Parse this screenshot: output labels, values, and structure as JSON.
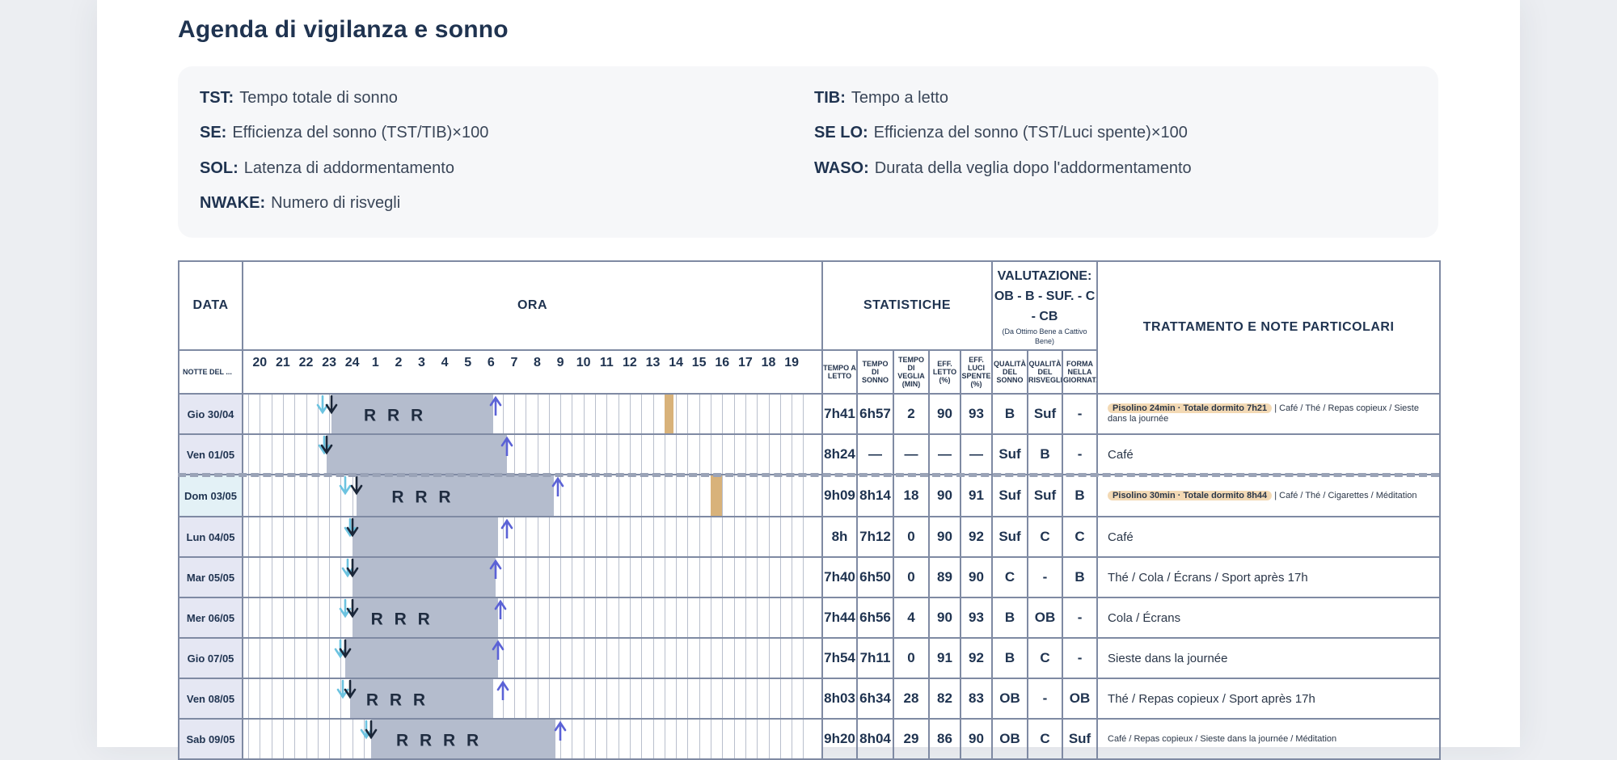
{
  "page": {
    "title": "Agenda di vigilanza e sonno"
  },
  "legend": [
    {
      "abbr": "TST:",
      "text": "Tempo totale di sonno"
    },
    {
      "abbr": "TIB:",
      "text": "Tempo a letto"
    },
    {
      "abbr": "SE:",
      "text": "Efficienza del sonno (TST/TIB)×100"
    },
    {
      "abbr": "SE LO:",
      "text": "Efficienza del sonno (TST/Luci spente)×100"
    },
    {
      "abbr": "SOL:",
      "text": "Latenza di addormentamento"
    },
    {
      "abbr": "WASO:",
      "text": "Durata della veglia dopo l'addormentamento"
    },
    {
      "abbr": "NWAKE:",
      "text": "Numero di risvegli"
    }
  ],
  "table": {
    "headers": {
      "data": "DATA",
      "ora": "ORA",
      "statistiche": "STATISTICHE",
      "valutazione": "VALUTAZIONE: OB - B - SUF. - C - CB",
      "valutazione_note": "(Da Ottimo Bene a Cattivo Bene)",
      "trattamento": "TRATTAMENTO E NOTE PARTICOLARI",
      "notte_del": "NOTTE DEL ..."
    },
    "hours": [
      "20",
      "21",
      "22",
      "23",
      "24",
      "1",
      "2",
      "3",
      "4",
      "5",
      "6",
      "7",
      "8",
      "9",
      "10",
      "11",
      "12",
      "13",
      "14",
      "15",
      "16",
      "17",
      "18",
      "19"
    ],
    "stat_columns": [
      "TEMPO A LETTO",
      "TEMPO DI SONNO",
      "TEMPO DI VEGLIA (MIN)",
      "EFF. LETTO (%)",
      "EFF. LUCI SPENTE (%)"
    ],
    "eval_columns": [
      "QUALITÀ DEL SONNO",
      "QUALITÀ DEL RISVEGLIO",
      "FORMA NELLA GIORNATA"
    ],
    "rows": [
      {
        "date": "Gio 30/04",
        "stats": [
          "7h41",
          "6h57",
          "2",
          "90",
          "93"
        ],
        "eval": [
          "B",
          "Suf",
          "-"
        ],
        "pill": "Pisolino 24min · Totale dormito 7h21",
        "note": "| Café / Thé / Repas copieux / Sieste dans la journée",
        "small": true
      },
      {
        "date": "Ven 01/05",
        "stats": [
          "8h24",
          "—",
          "—",
          "—",
          "—"
        ],
        "eval": [
          "Suf",
          "B",
          "-"
        ],
        "pill": "",
        "note": "Café",
        "small": false
      },
      {
        "date": "Dom 03/05",
        "stats": [
          "9h09",
          "8h14",
          "18",
          "90",
          "91"
        ],
        "eval": [
          "Suf",
          "Suf",
          "B"
        ],
        "pill": "Pisolino 30min · Totale dormito 8h44",
        "note": "| Café / Thé / Cigarettes / Méditation",
        "small": true
      },
      {
        "date": "Lun 04/05",
        "stats": [
          "8h",
          "7h12",
          "0",
          "90",
          "92"
        ],
        "eval": [
          "Suf",
          "C",
          "C"
        ],
        "pill": "",
        "note": "Café",
        "small": false
      },
      {
        "date": "Mar 05/05",
        "stats": [
          "7h40",
          "6h50",
          "0",
          "89",
          "90"
        ],
        "eval": [
          "C",
          "-",
          "B"
        ],
        "pill": "",
        "note": "Thé / Cola / Écrans / Sport après 17h",
        "small": false
      },
      {
        "date": "Mer 06/05",
        "stats": [
          "7h44",
          "6h56",
          "4",
          "90",
          "93"
        ],
        "eval": [
          "B",
          "OB",
          "-"
        ],
        "pill": "",
        "note": "Cola / Écrans",
        "small": false
      },
      {
        "date": "Gio 07/05",
        "stats": [
          "7h54",
          "7h11",
          "0",
          "91",
          "92"
        ],
        "eval": [
          "B",
          "C",
          "-"
        ],
        "pill": "",
        "note": "Sieste dans la journée",
        "small": false
      },
      {
        "date": "Ven 08/05",
        "stats": [
          "8h03",
          "6h34",
          "28",
          "82",
          "83"
        ],
        "eval": [
          "OB",
          "-",
          "OB"
        ],
        "pill": "",
        "note": "Thé / Repas copieux / Sport après 17h",
        "small": false
      },
      {
        "date": "Sab 09/05",
        "stats": [
          "9h20",
          "8h04",
          "29",
          "86",
          "90"
        ],
        "eval": [
          "OB",
          "C",
          "Suf"
        ],
        "pill": "",
        "note": "Café / Repas copieux / Sieste dans la journée / Méditation",
        "small": true
      }
    ]
  },
  "sleep_bars": [
    {
      "lights_off": 23.2,
      "asleep": 23.6,
      "wake": 30.6,
      "up": 30.7,
      "r": "R R R",
      "r_start": 25.0,
      "nap": [
        14.0,
        14.4
      ]
    },
    {
      "lights_off": 23.3,
      "asleep": 23.4,
      "wake": 31.2,
      "up": 31.2,
      "r": "",
      "r_start": 0,
      "nap": null
    },
    {
      "lights_off": 24.2,
      "asleep": 24.7,
      "wake": 33.2,
      "up": 33.4,
      "r": "R R R",
      "r_start": 26.2,
      "nap": [
        16.0,
        16.5
      ]
    },
    {
      "lights_off": 24.4,
      "asleep": 24.5,
      "wake": 30.8,
      "up": 31.2,
      "r": "",
      "r_start": 0,
      "nap": null
    },
    {
      "lights_off": 24.3,
      "asleep": 24.5,
      "wake": 30.7,
      "up": 30.7,
      "r": "",
      "r_start": 0,
      "nap": null
    },
    {
      "lights_off": 24.2,
      "asleep": 24.5,
      "wake": 30.8,
      "up": 30.9,
      "r": "R R R",
      "r_start": 25.3,
      "nap": null
    },
    {
      "lights_off": 24.0,
      "asleep": 24.2,
      "wake": 30.8,
      "up": 30.8,
      "r": "",
      "r_start": 0,
      "nap": null
    },
    {
      "lights_off": 24.1,
      "asleep": 24.4,
      "wake": 30.6,
      "up": 31.0,
      "r": "R R R",
      "r_start": 25.1,
      "nap": null
    },
    {
      "lights_off": 25.1,
      "asleep": 25.3,
      "wake": 33.3,
      "up": 33.5,
      "r": "R R R R",
      "r_start": 26.4,
      "nap": null
    }
  ],
  "colors": {
    "accent": "#5b62d6",
    "arrow_dark": "#1a2638",
    "arrow_light": "#6cc3e0",
    "nap": "#d8b27a",
    "sleep": "#b4bccd"
  }
}
